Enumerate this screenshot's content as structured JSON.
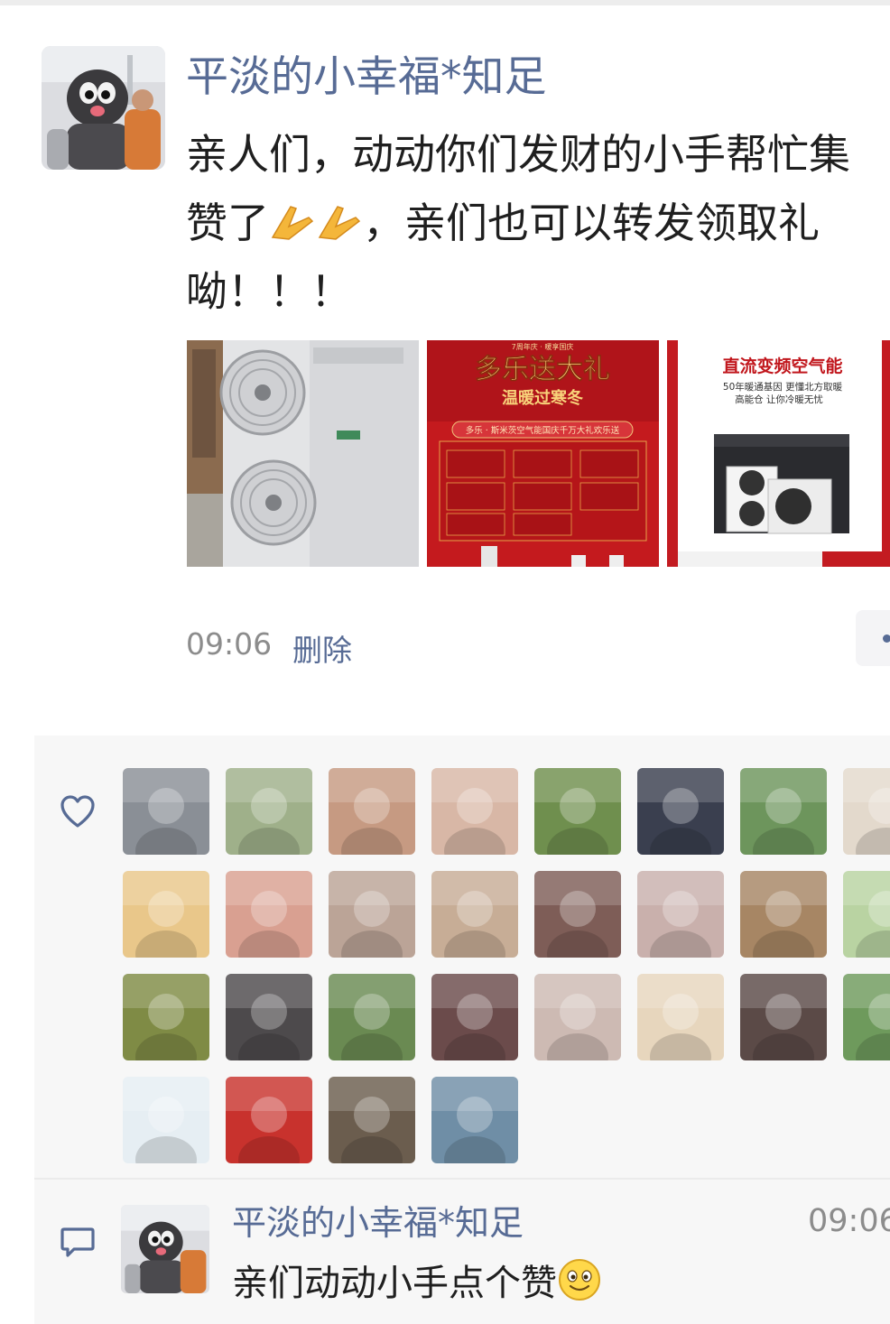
{
  "post": {
    "author": "平淡的小幸福*知足",
    "text_line1": "亲人们，动动你们发财的小手帮忙集",
    "text_line2_prefix": "赞了",
    "text_line2_suffix": "，亲们也可以转发领取礼",
    "text_line3": "呦！！！",
    "emoji": "pray-hands-emoji",
    "time": "09:06",
    "delete_label": "删除",
    "images": [
      {
        "icon": "air-source-heat-pump-unit-photo"
      },
      {
        "icon": "promo-poster-red",
        "header": "7周年庆 · 暖享国庆",
        "title": "多乐送大礼",
        "subtitle": "温暖过寒冬",
        "banner": "多乐 · 斯米茨空气能国庆千万大礼欢乐送"
      },
      {
        "icon": "heat-pump-product-ad",
        "title": "直流变频空气能",
        "line1": "50年暖通基因 更懂北方取暖",
        "line2": "高能仓 让你冷暖无忧"
      }
    ]
  },
  "likes": {
    "icon": "heart-icon",
    "avatars": [
      {
        "icon": "mole-mascot-avatar",
        "color": "#8a8f96"
      },
      {
        "icon": "child-outdoor-avatar",
        "color": "#9fb08a"
      },
      {
        "icon": "hands-avatar",
        "color": "#c69a82"
      },
      {
        "icon": "kids-filter-avatar",
        "color": "#d8b7a6"
      },
      {
        "icon": "woman-forest-avatar",
        "color": "#6f8f4e"
      },
      {
        "icon": "girl-cat-hat-avatar",
        "color": "#3a3f4f"
      },
      {
        "icon": "trees-avatar",
        "color": "#6d955c"
      },
      {
        "icon": "blessing-card-avatar",
        "color": "#e3d9cc"
      },
      {
        "icon": "tiger-cartoon-avatar",
        "color": "#e9c78a"
      },
      {
        "icon": "woman-pink-avatar",
        "color": "#d9a091"
      },
      {
        "icon": "baby-avatar",
        "color": "#bba497"
      },
      {
        "icon": "woman-short-hair-avatar",
        "color": "#c7ad96"
      },
      {
        "icon": "family-avatar",
        "color": "#7e5d57"
      },
      {
        "icon": "woman-portrait-avatar",
        "color": "#c9b0ac"
      },
      {
        "icon": "street-woman-avatar",
        "color": "#a78664"
      },
      {
        "icon": "green-tea-avatar",
        "color": "#b9d3a2"
      },
      {
        "icon": "sunflowers-avatar",
        "color": "#7f8b45"
      },
      {
        "icon": "graffiti-avatar",
        "color": "#4d4a4c"
      },
      {
        "icon": "garden-path-avatar",
        "color": "#6a8a52"
      },
      {
        "icon": "woman-closeup-avatar",
        "color": "#6b4b4b"
      },
      {
        "icon": "woman-blonde-avatar",
        "color": "#cdbab3"
      },
      {
        "icon": "flower-avatar",
        "color": "#e7d6bd"
      },
      {
        "icon": "woman-smile-avatar",
        "color": "#5b4a47"
      },
      {
        "icon": "field-person-avatar",
        "color": "#6e9a5c"
      },
      {
        "icon": "panda-mascot-avatar",
        "color": "#e6eef3"
      },
      {
        "icon": "flag-woman-avatar",
        "color": "#c8322d"
      },
      {
        "icon": "doraemon-toy-avatar",
        "color": "#6b5d4e"
      },
      {
        "icon": "bridge-child-avatar",
        "color": "#6f8ea6"
      }
    ]
  },
  "comment": {
    "icon": "comment-icon",
    "author": "平淡的小幸福*知足",
    "time": "09:06",
    "text": "亲们动动小手点个赞",
    "emoji": "smile-emoji"
  },
  "colors": {
    "link": "#576b95",
    "text": "#1f1f1f",
    "muted": "#8c8c8c",
    "panel": "#f7f7f7"
  }
}
